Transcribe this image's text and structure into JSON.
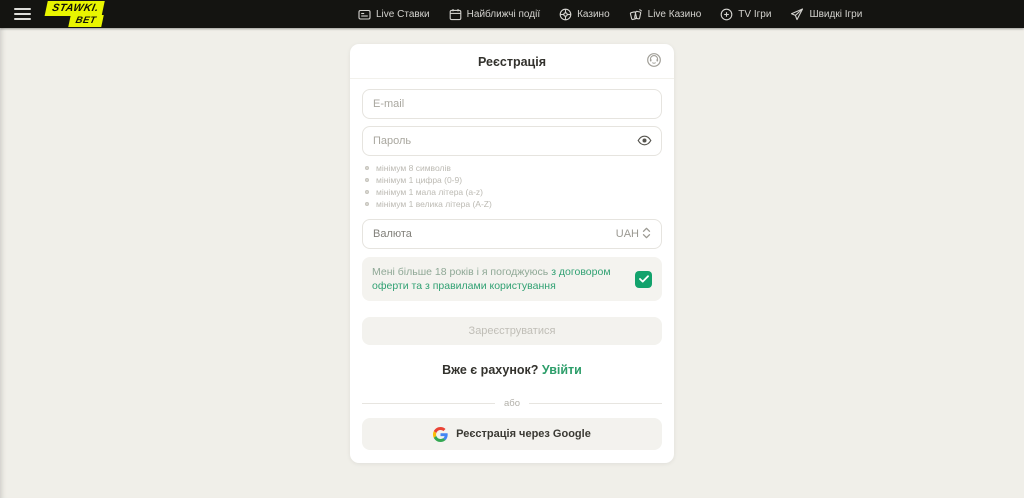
{
  "header": {
    "logo": {
      "line1": "STAWKI.",
      "line2": "BET"
    },
    "nav": [
      {
        "label": "Live Ставки"
      },
      {
        "label": "Найближчі події"
      },
      {
        "label": "Казино"
      },
      {
        "label": "Live Казино"
      },
      {
        "label": "TV Ігри"
      },
      {
        "label": "Швидкі Ігри"
      }
    ]
  },
  "registration": {
    "title": "Реєстрація",
    "email_placeholder": "E-mail",
    "password_placeholder": "Пароль",
    "password_requirements": [
      "мінімум 8 символів",
      "мінімум 1 цифра (0-9)",
      "мінімум 1 мала літера (a-z)",
      "мінімум 1 велика літера (A-Z)"
    ],
    "currency_label": "Валюта",
    "currency_value": "UAH",
    "terms": {
      "text_start": "Мені більше 18 років і я погоджуюсь",
      "link1": "з договором оферти",
      "text_mid": "та з",
      "link2": "правилами користування",
      "checked": true
    },
    "submit_label": "Зареєструватися",
    "login_prompt": "Вже є рахунок?",
    "login_link": "Увійти",
    "divider_label": "або",
    "google_button_label": "Реєстрація через Google"
  },
  "colors": {
    "brand_yellow": "#e9f500",
    "header_bg": "#141411",
    "page_bg": "#f0efe9",
    "accent_green": "#2d9e6a",
    "checkbox_green": "#12a26c",
    "terms_text_green": "#8fa896"
  }
}
